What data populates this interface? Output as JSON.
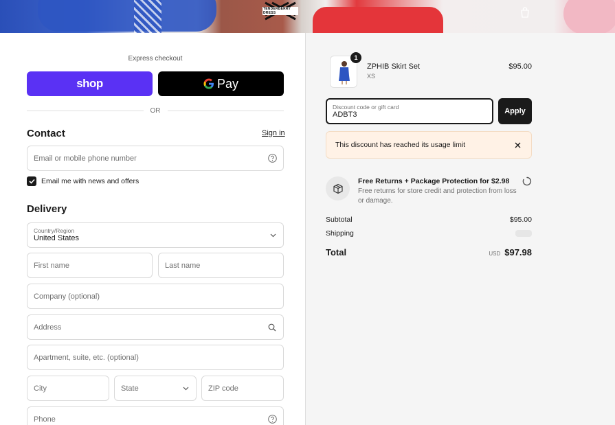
{
  "banner": {
    "brand_text": "TENDERBERRY DRESS",
    "bag_icon": "shopping-bag-icon"
  },
  "express": {
    "title": "Express checkout",
    "shop_label": "shop",
    "gpay_label": "Pay",
    "or_label": "OR"
  },
  "contact": {
    "title": "Contact",
    "signin_label": "Sign in",
    "email_placeholder": "Email or mobile phone number",
    "newsletter_label": "Email me with news and offers",
    "newsletter_checked": true
  },
  "delivery": {
    "title": "Delivery",
    "country_label": "Country/Region",
    "country_value": "United States",
    "first_name_placeholder": "First name",
    "last_name_placeholder": "Last name",
    "company_placeholder": "Company (optional)",
    "address_placeholder": "Address",
    "apartment_placeholder": "Apartment, suite, etc. (optional)",
    "city_placeholder": "City",
    "state_placeholder": "State",
    "zip_placeholder": "ZIP code",
    "phone_placeholder": "Phone"
  },
  "order": {
    "product": {
      "name": "ZPHIB Skirt Set",
      "variant": "XS",
      "price": "$95.00",
      "quantity": "1"
    },
    "discount": {
      "label": "Discount code or gift card",
      "value": "ADBT3",
      "apply_label": "Apply"
    },
    "alert": "This discount has reached its usage limit",
    "protection": {
      "title": "Free Returns + Package Protection for $2.98",
      "description": "Free returns for store credit and protection from loss or damage."
    },
    "subtotal_label": "Subtotal",
    "subtotal_value": "$95.00",
    "shipping_label": "Shipping",
    "total_label": "Total",
    "total_currency": "USD",
    "total_value": "$97.98"
  },
  "colors": {
    "shop_purple": "#5a31f4",
    "alert_bg": "#fff2e6",
    "dark": "#1a1a1a"
  }
}
